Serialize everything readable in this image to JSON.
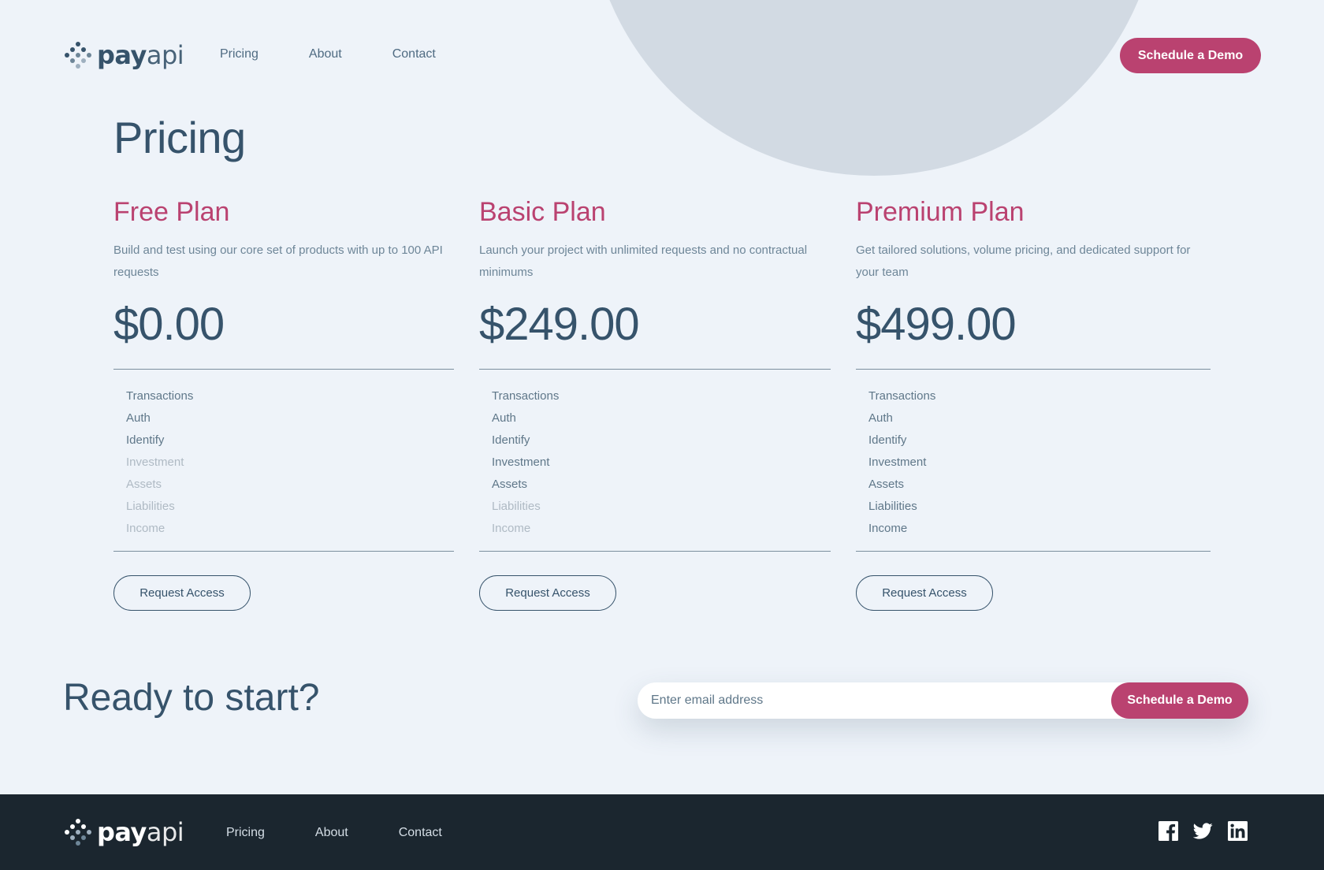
{
  "brand": {
    "bold": "pay",
    "light": "api"
  },
  "nav": {
    "items": [
      "Pricing",
      "About",
      "Contact"
    ]
  },
  "header": {
    "cta_label": "Schedule a Demo"
  },
  "page": {
    "title": "Pricing"
  },
  "plans": [
    {
      "name": "Free Plan",
      "description": "Build and test using our core set of products with up to 100 API requests",
      "price": "$0.00",
      "features": [
        {
          "label": "Transactions",
          "included": true
        },
        {
          "label": "Auth",
          "included": true
        },
        {
          "label": "Identify",
          "included": true
        },
        {
          "label": "Investment",
          "included": false
        },
        {
          "label": "Assets",
          "included": false
        },
        {
          "label": "Liabilities",
          "included": false
        },
        {
          "label": "Income",
          "included": false
        }
      ],
      "button_label": "Request Access"
    },
    {
      "name": "Basic Plan",
      "description": "Launch your project with unlimited requests and no contractual minimums",
      "price": "$249.00",
      "features": [
        {
          "label": "Transactions",
          "included": true
        },
        {
          "label": "Auth",
          "included": true
        },
        {
          "label": "Identify",
          "included": true
        },
        {
          "label": "Investment",
          "included": true
        },
        {
          "label": "Assets",
          "included": true
        },
        {
          "label": "Liabilities",
          "included": false
        },
        {
          "label": "Income",
          "included": false
        }
      ],
      "button_label": "Request Access"
    },
    {
      "name": "Premium Plan",
      "description": "Get tailored solutions, volume pricing, and dedicated support for your team",
      "price": "$499.00",
      "features": [
        {
          "label": "Transactions",
          "included": true
        },
        {
          "label": "Auth",
          "included": true
        },
        {
          "label": "Identify",
          "included": true
        },
        {
          "label": "Investment",
          "included": true
        },
        {
          "label": "Assets",
          "included": true
        },
        {
          "label": "Liabilities",
          "included": true
        },
        {
          "label": "Income",
          "included": true
        }
      ],
      "button_label": "Request Access"
    }
  ],
  "cta": {
    "title": "Ready to start?",
    "email_placeholder": "Enter email address",
    "button_label": "Schedule a Demo"
  },
  "footer": {
    "nav": [
      "Pricing",
      "About",
      "Contact"
    ],
    "socials": [
      "facebook-icon",
      "twitter-icon",
      "linkedin-icon"
    ]
  },
  "colors": {
    "background": "#EEF3F9",
    "accent": "#BA4270",
    "text_dark": "#36536B",
    "footer_bg": "#1B262F",
    "decor_circle": "#D2DAE3"
  }
}
